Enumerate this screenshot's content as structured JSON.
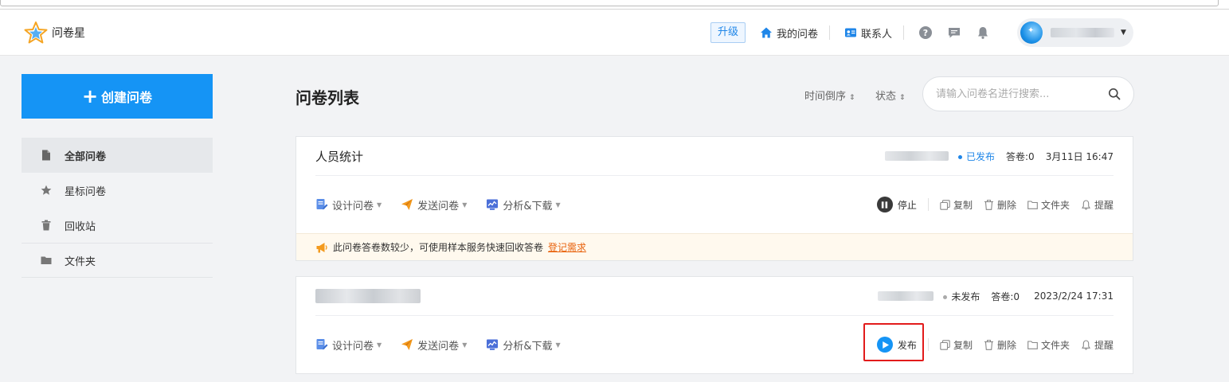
{
  "app": {
    "logo_text": "问卷星"
  },
  "header": {
    "upgrade_label": "升级",
    "my_surveys_label": "我的问卷",
    "contacts_label": "联系人",
    "icons": [
      "help-icon",
      "message-icon",
      "bell-icon"
    ]
  },
  "sidebar": {
    "create_label": "创建问卷",
    "items": [
      {
        "label": "全部问卷",
        "icon": "document-icon",
        "active": true
      },
      {
        "label": "星标问卷",
        "icon": "star-icon",
        "active": false
      },
      {
        "label": "回收站",
        "icon": "trash-icon",
        "active": false
      },
      {
        "label": "文件夹",
        "icon": "folder-icon",
        "active": false
      }
    ]
  },
  "main": {
    "title": "问卷列表",
    "sort_time_label": "时间倒序",
    "sort_status_label": "状态",
    "search": {
      "placeholder": "请输入问卷名进行搜索...",
      "value": ""
    }
  },
  "surveys": [
    {
      "title": "人员统计",
      "status": "已发布",
      "status_color": "#1f86e8",
      "answers": "答卷:0",
      "date": "3月11日 16:47",
      "primary_action": "停止",
      "tip": {
        "text": "此问卷答卷数较少，可使用样本服务快速回收答卷",
        "link": "登记需求"
      }
    },
    {
      "title": "",
      "status": "未发布",
      "status_color": "#aaaaaa",
      "answers": "答卷:0",
      "date": "2023/2/24 17:31",
      "primary_action": "发布"
    }
  ],
  "card_actions": {
    "design": "设计问卷",
    "send": "发送问卷",
    "analyze": "分析&下载",
    "copy": "复制",
    "delete": "删除",
    "folder": "文件夹",
    "remind": "提醒"
  },
  "colors": {
    "primary": "#1594f5",
    "accent_blue": "#1f86e8",
    "highlight": "#e21b1b",
    "tip_link": "#e8620c"
  }
}
